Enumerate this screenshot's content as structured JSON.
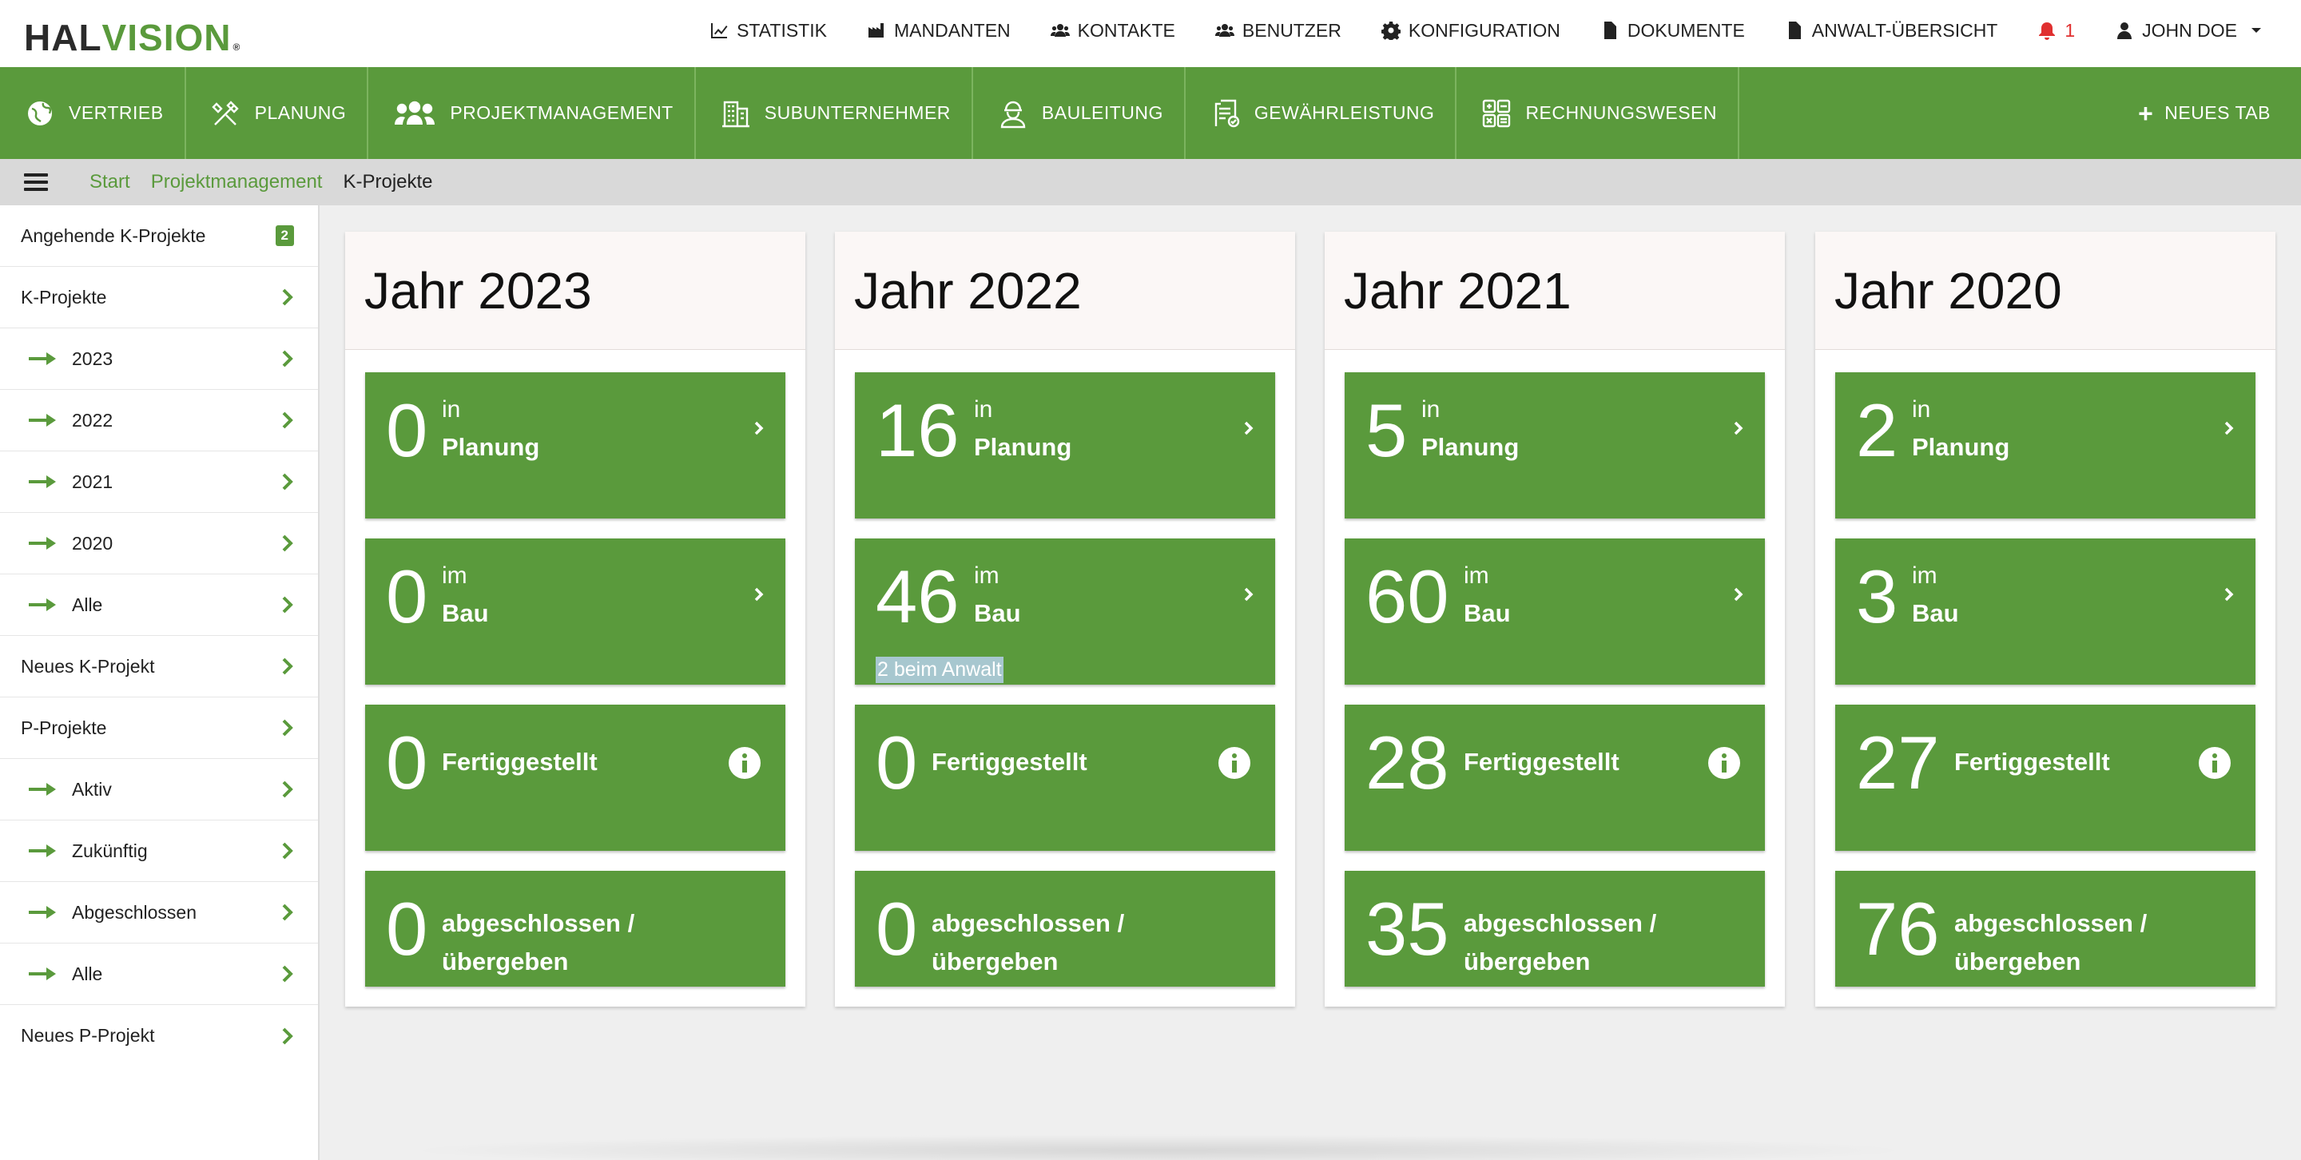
{
  "brand": {
    "logo_part1": "HAL",
    "logo_part2": "VISION",
    "logo_mark": "®"
  },
  "topnav": [
    {
      "label": "STATISTIK",
      "icon": "chart-line-icon"
    },
    {
      "label": "MANDANTEN",
      "icon": "industry-icon"
    },
    {
      "label": "KONTAKTE",
      "icon": "users-icon"
    },
    {
      "label": "BENUTZER",
      "icon": "users-icon"
    },
    {
      "label": "KONFIGURATION",
      "icon": "gear-icon"
    },
    {
      "label": "DOKUMENTE",
      "icon": "file-icon"
    },
    {
      "label": "ANWALT-ÜBERSICHT",
      "icon": "file-icon"
    },
    {
      "label": "1",
      "icon": "bell-icon"
    },
    {
      "label": "JOHN DOE",
      "icon": "user-icon"
    }
  ],
  "modules": [
    {
      "label": "VERTRIEB",
      "icon": "globe-icon"
    },
    {
      "label": "PLANUNG",
      "icon": "tools-icon"
    },
    {
      "label": "PROJEKTMANAGEMENT",
      "icon": "team-icon"
    },
    {
      "label": "SUBUNTERNEHMER",
      "icon": "building-icon"
    },
    {
      "label": "BAULEITUNG",
      "icon": "worker-icon"
    },
    {
      "label": "GEWÄHRLEISTUNG",
      "icon": "certificate-icon"
    },
    {
      "label": "RECHNUNGSWESEN",
      "icon": "calculator-icon"
    }
  ],
  "new_tab": "NEUES TAB",
  "breadcrumb": [
    "Start",
    "Projektmanagement",
    "K-Projekte"
  ],
  "sidebar": [
    {
      "label": "Angehende K-Projekte",
      "badge": "2",
      "sub": false
    },
    {
      "label": "K-Projekte",
      "sub": false
    },
    {
      "label": "2023",
      "sub": true
    },
    {
      "label": "2022",
      "sub": true
    },
    {
      "label": "2021",
      "sub": true
    },
    {
      "label": "2020",
      "sub": true
    },
    {
      "label": "Alle",
      "sub": true
    },
    {
      "label": "Neues K-Projekt",
      "sub": false
    },
    {
      "label": "P-Projekte",
      "sub": false
    },
    {
      "label": "Aktiv",
      "sub": true
    },
    {
      "label": "Zukünftig",
      "sub": true
    },
    {
      "label": "Abgeschlossen",
      "sub": true
    },
    {
      "label": "Alle",
      "sub": true
    },
    {
      "label": "Neues P-Projekt",
      "sub": false
    }
  ],
  "labels": {
    "planung_1": "in",
    "planung_2": "Planung",
    "bau_1": "im",
    "bau_2": "Bau",
    "fertig": "Fertiggestellt",
    "abgeschlossen_1": "abgeschlossen /",
    "abgeschlossen_2": "übergeben"
  },
  "years": [
    {
      "title": "Jahr 2023",
      "planung": "0",
      "bau": "0",
      "bau_note": "",
      "fertig": "0",
      "abgeschlossen": "0"
    },
    {
      "title": "Jahr 2022",
      "planung": "16",
      "bau": "46",
      "bau_note": "2 beim Anwalt",
      "fertig": "0",
      "abgeschlossen": "0"
    },
    {
      "title": "Jahr 2021",
      "planung": "5",
      "bau": "60",
      "bau_note": "",
      "fertig": "28",
      "abgeschlossen": "35"
    },
    {
      "title": "Jahr 2020",
      "planung": "2",
      "bau": "3",
      "bau_note": "",
      "fertig": "27",
      "abgeschlossen": "76"
    }
  ],
  "colors": {
    "brand_green": "#5a9a3c",
    "alert_red": "#e03030",
    "highlight": "#a7c7cf"
  }
}
